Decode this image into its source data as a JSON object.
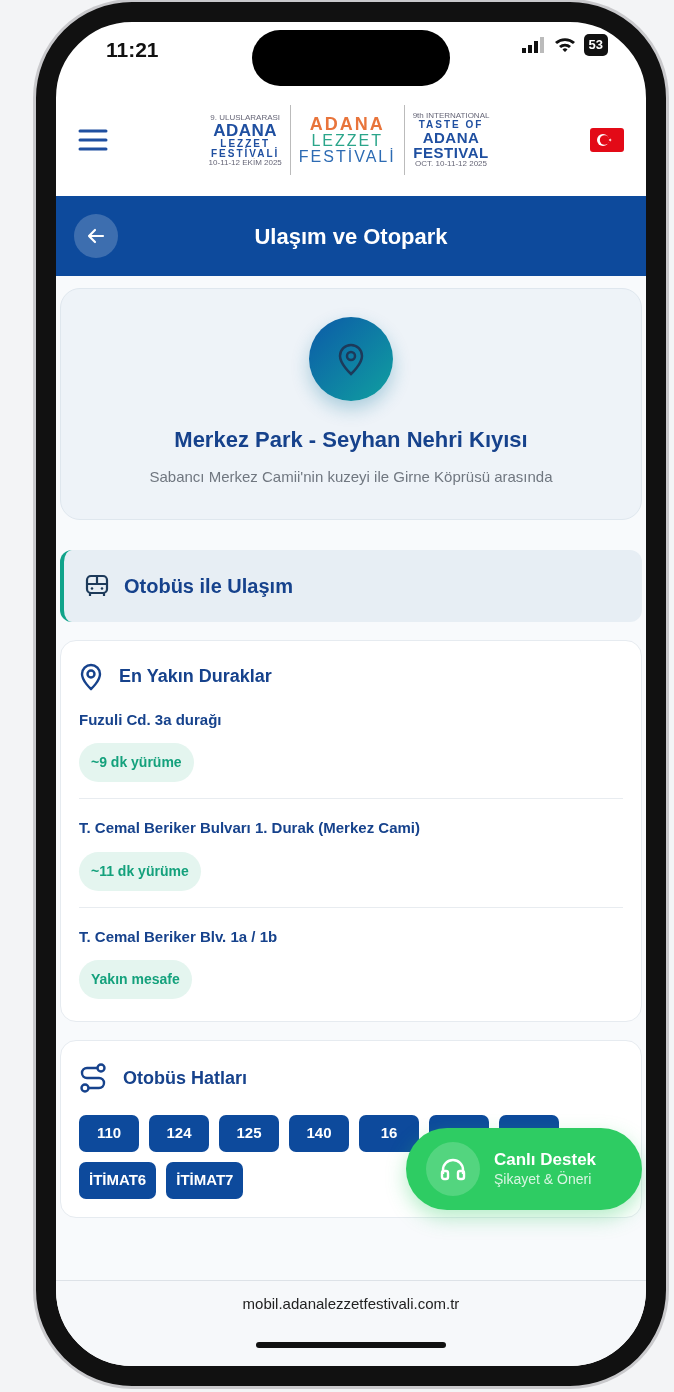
{
  "status_bar": {
    "time": "11:21",
    "battery": "53"
  },
  "header": {
    "logo": {
      "left": [
        "9. ULUSLARARASI",
        "ADANA",
        "LEZZET",
        "FESTİVALİ",
        "10-11-12 EKİM 2025"
      ],
      "center": [
        "ADANA",
        "LEZZET",
        "FESTİVALİ"
      ],
      "right": [
        "9th INTERNATIONAL",
        "TASTE OF",
        "ADANA",
        "FESTIVAL",
        "OCT. 10-11-12 2025"
      ]
    }
  },
  "title_bar": {
    "title": "Ulaşım ve Otopark"
  },
  "location": {
    "name": "Merkez Park - Seyhan Nehri Kıyısı",
    "description": "Sabancı Merkez Camii'nin kuzeyi ile Girne Köprüsü arasında"
  },
  "section": {
    "title": "Otobüs ile Ulaşım"
  },
  "nearest_stops": {
    "title": "En Yakın Duraklar",
    "stops": [
      {
        "name": "Fuzuli Cd. 3a durağı",
        "distance": "~9 dk yürüme"
      },
      {
        "name": "T. Cemal Beriker Bulvarı 1. Durak (Merkez Cami)",
        "distance": "~11 dk yürüme"
      },
      {
        "name": "T. Cemal Beriker Blv. 1a / 1b",
        "distance": "Yakın mesafe"
      }
    ]
  },
  "bus_lines": {
    "title": "Otobüs Hatları",
    "lines": [
      {
        "kind": "label",
        "label": "110"
      },
      {
        "kind": "label",
        "label": "124"
      },
      {
        "kind": "label",
        "label": "125"
      },
      {
        "kind": "label",
        "label": "140"
      },
      {
        "kind": "label",
        "label": "16"
      },
      {
        "kind": "covered"
      },
      {
        "kind": "covered"
      },
      {
        "kind": "label",
        "label": "İTİMAT6"
      },
      {
        "kind": "label",
        "label": "İTİMAT7"
      }
    ]
  },
  "support_button": {
    "title": "Canlı Destek",
    "subtitle": "Şikayet & Öneri"
  },
  "browser_bar": {
    "url": "mobil.adanalezzetfestivali.com.tr"
  }
}
